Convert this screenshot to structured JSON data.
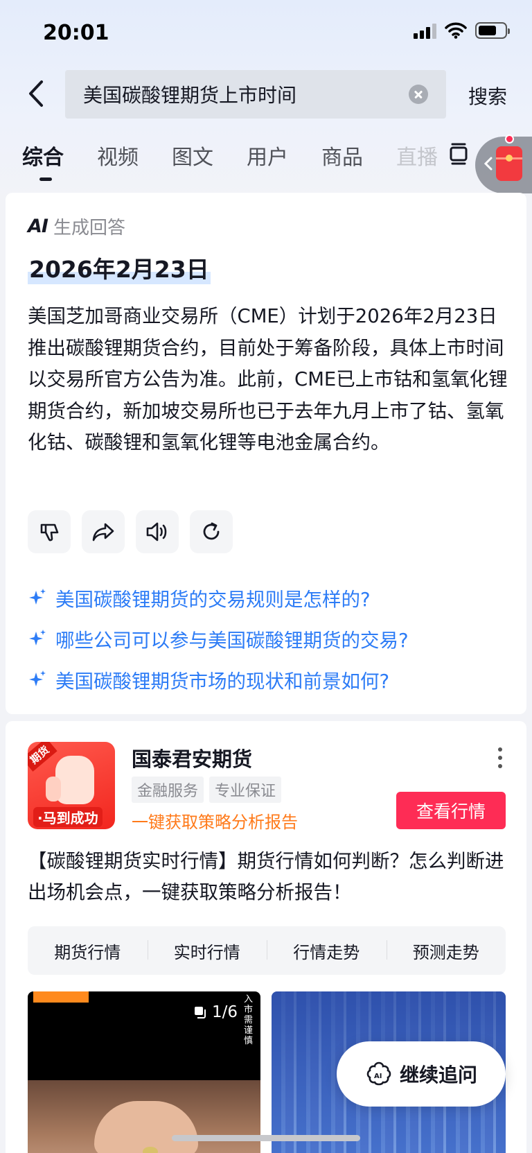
{
  "status_bar": {
    "time": "20:01"
  },
  "search": {
    "query": "美国碳酸锂期货上市时间",
    "button_label": "搜索"
  },
  "tabs": [
    {
      "label": "综合",
      "active": true
    },
    {
      "label": "视频"
    },
    {
      "label": "图文"
    },
    {
      "label": "用户"
    },
    {
      "label": "商品"
    },
    {
      "label": "直播"
    }
  ],
  "ai_answer": {
    "label_mark": "AI",
    "label_text": "生成回答",
    "title": "2026年2月23日",
    "body": "美国芝加哥商业交易所（CME）计划于2026年2月23日推出碳酸锂期货合约，目前处于筹备阶段，具体上市时间以交易所官方公告为准。此前，CME已上市钴和氢氧化锂期货合约，新加坡交易所也已于去年九月上市了钴、氢氧化钴、碳酸锂和氢氧化锂等电池金属合约。",
    "actions": [
      "thumbs-down-icon",
      "share-icon",
      "speaker-icon",
      "refresh-icon"
    ],
    "suggestions": [
      "美国碳酸锂期货的交易规则是怎样的?",
      "哪些公司可以参与美国碳酸锂期货的交易?",
      "美国碳酸锂期货市场的现状和前景如何?"
    ]
  },
  "ad": {
    "logo_badge": "期货",
    "logo_caption": "·马到成功",
    "advertiser": "国泰君安期货",
    "tags": [
      "金融服务",
      "专业保证"
    ],
    "promo": "一键获取策略分析报告",
    "cta": "查看行情",
    "description": "【碳酸锂期货实时行情】期货行情如何判断？怎么判断进出场机会点，一键获取策略分析报告！",
    "quick_links": [
      "期货行情",
      "实时行情",
      "行情走势",
      "预测走势"
    ],
    "media_count": "1/6",
    "vertical_caption": "入市需谨慎"
  },
  "followup": {
    "label": "继续追问"
  },
  "colors": {
    "accent": "#fe2c55",
    "link_blue": "#2d7cf6",
    "promo_orange": "#ff7a1a"
  }
}
